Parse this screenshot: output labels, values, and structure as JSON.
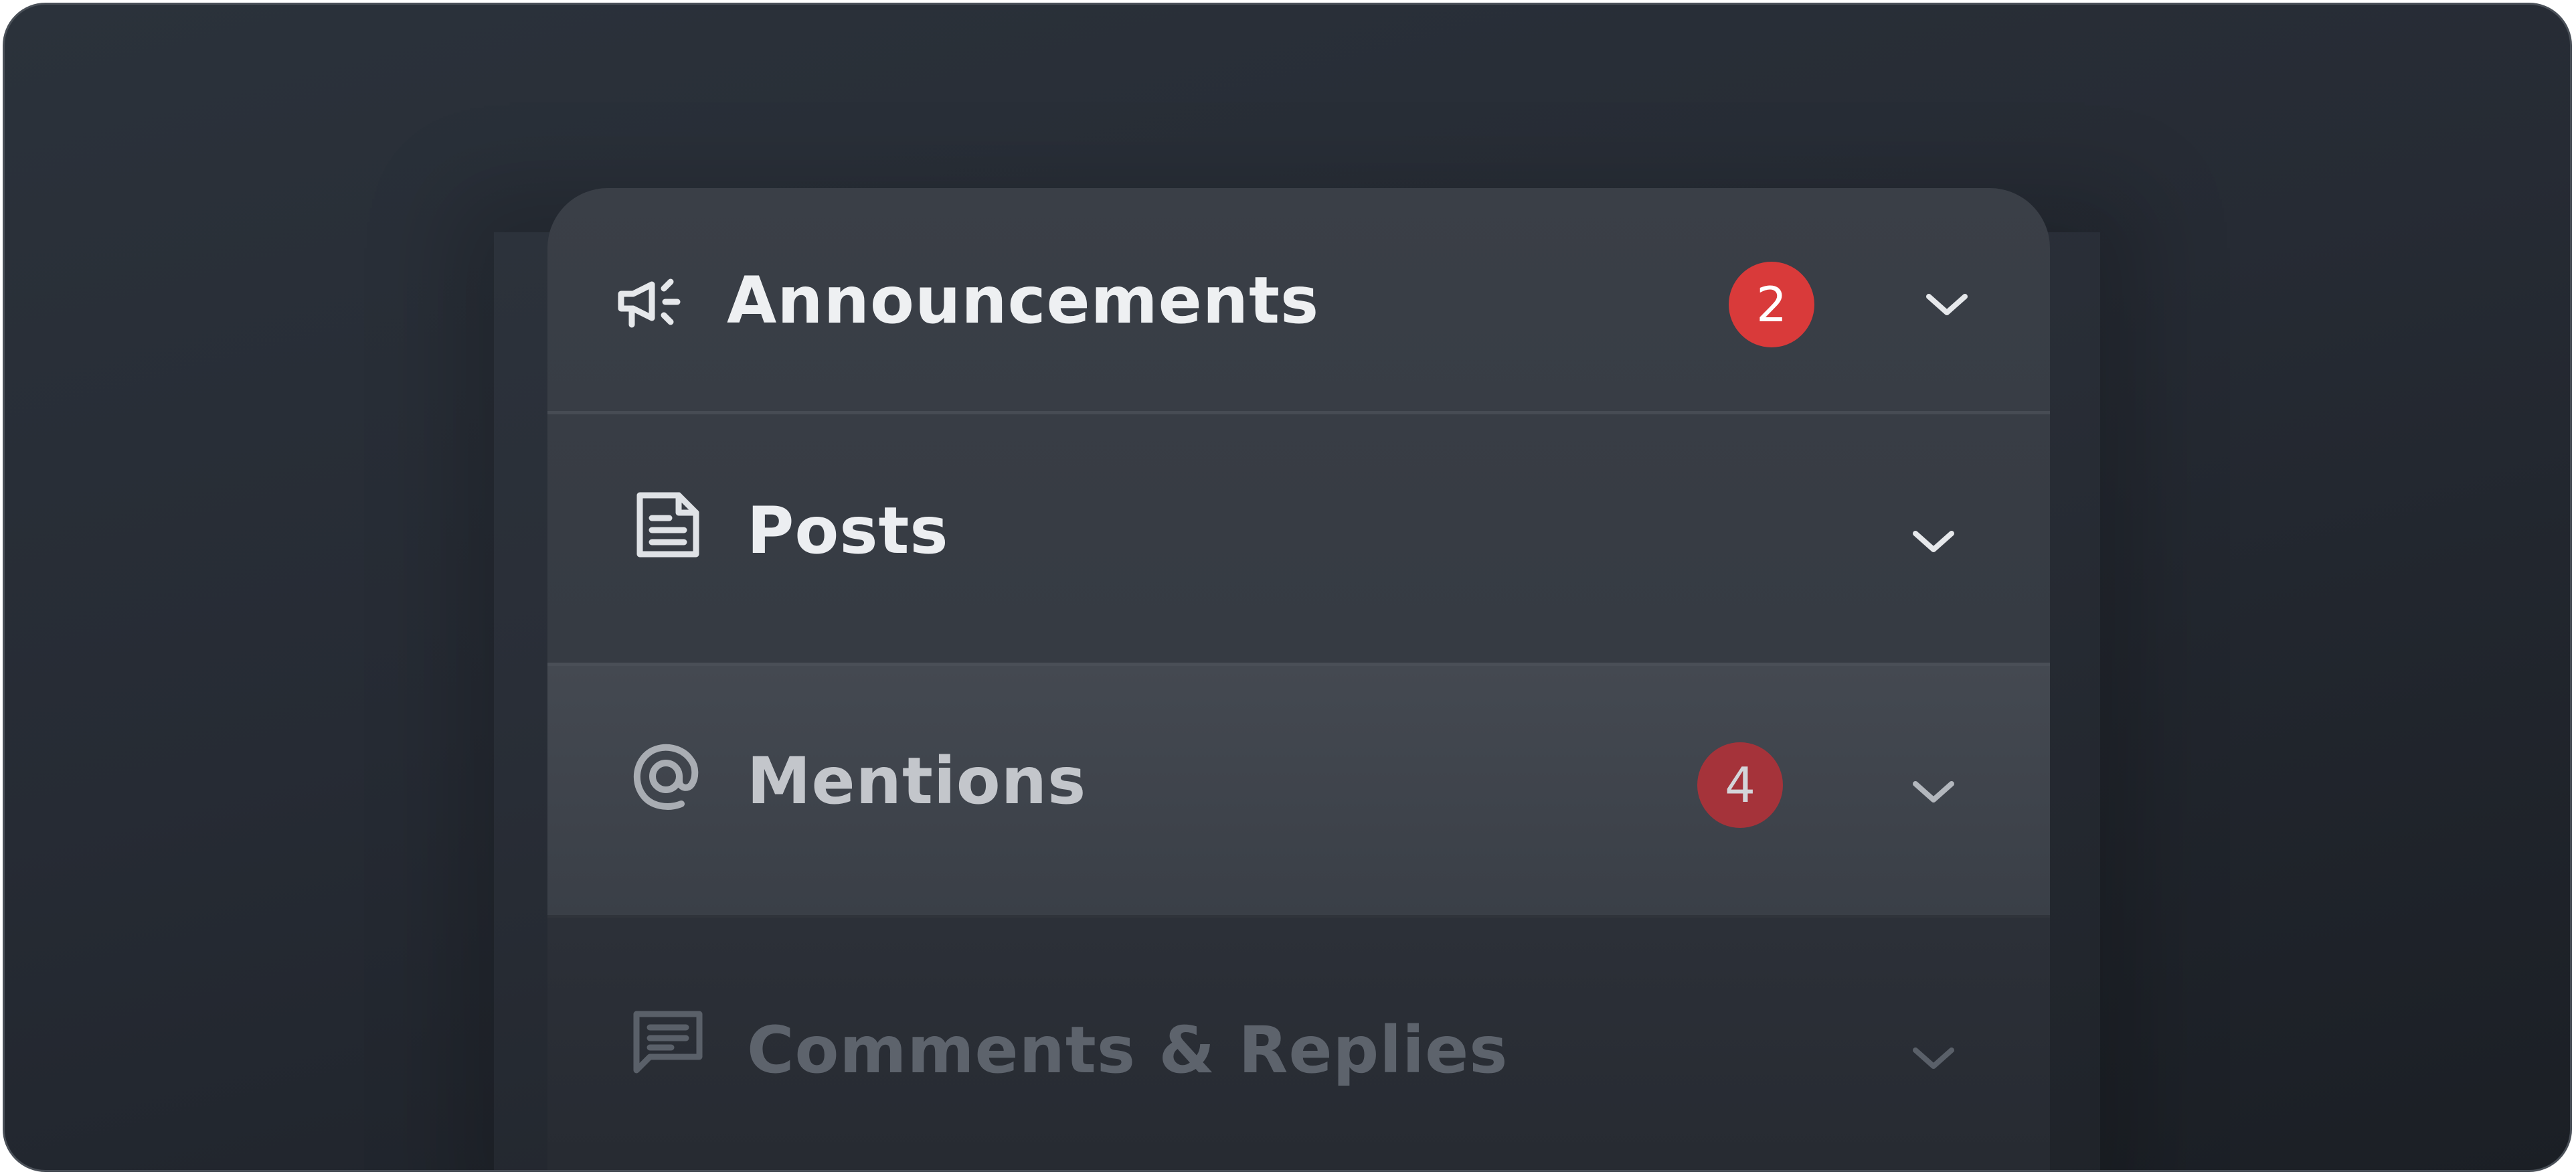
{
  "notifications": {
    "items": [
      {
        "label": "Announcements",
        "icon": "megaphone-icon",
        "badge": "2",
        "badge_color": "#d93a3a",
        "expanded": false
      },
      {
        "label": "Posts",
        "icon": "document-icon",
        "badge": "",
        "expanded": false
      },
      {
        "label": "Mentions",
        "icon": "at-sign-icon",
        "badge": "4",
        "badge_color": "#a5333a",
        "expanded": false
      },
      {
        "label": "Comments & Replies",
        "icon": "comment-icon",
        "badge": "",
        "expanded": false
      }
    ]
  },
  "colors": {
    "background": "#262b34",
    "panel": "#3a3f47",
    "badge_red": "#d93a3a",
    "text_primary": "#eef0f2"
  }
}
